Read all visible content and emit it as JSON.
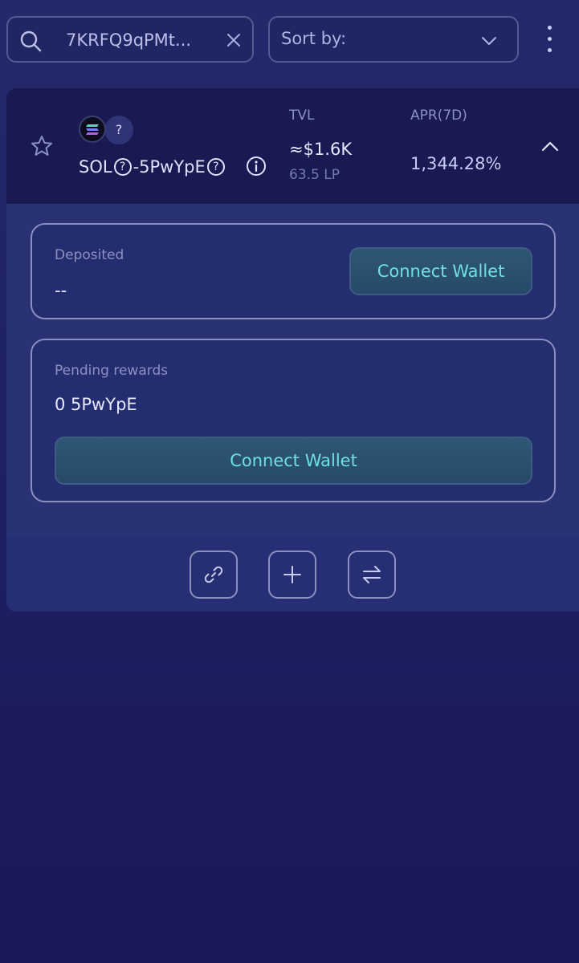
{
  "search": {
    "value": "7KRFQ9qPMt...",
    "placeholder": "Search"
  },
  "sort": {
    "label": "Sort by:"
  },
  "pool": {
    "token_a": "SOL",
    "token_b_logo_text": "?",
    "separator": "-",
    "token_b": "5PwYpE",
    "unknown_mark": "?",
    "tvl_label": "TVL",
    "tvl_value": "≈$1.6K",
    "tvl_lp": "63.5 LP",
    "apr_label": "APR(7D)",
    "apr_value": "1,344.28%"
  },
  "deposited": {
    "label": "Deposited",
    "value": "--",
    "button_label": "Connect Wallet"
  },
  "rewards": {
    "label": "Pending rewards",
    "value": "0 5PwYpE",
    "button_label": "Connect Wallet"
  },
  "icons": {
    "search": "search-icon",
    "clear": "close-icon",
    "sort": "chevron-down-icon",
    "more": "more-vertical-icon",
    "favorite": "star-icon",
    "info": "info-icon",
    "collapse": "chevron-up-icon",
    "link": "link-icon",
    "add": "plus-icon",
    "swap": "swap-icon"
  },
  "colors": {
    "accent_text": "#6fe0e0",
    "card_header": "#1a1a52",
    "panel_border": "#8a90c0"
  }
}
